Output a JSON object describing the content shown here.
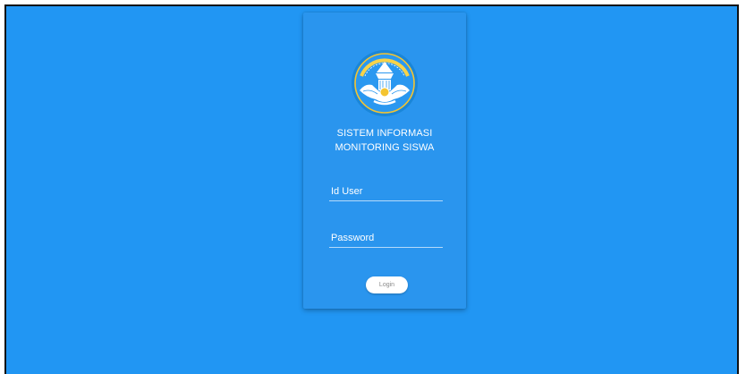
{
  "app": {
    "title_line1": "SISTEM INFORMASI",
    "title_line2": "MONITORING SISWA",
    "logo_icon": "tut-wuri-handayani-logo-icon"
  },
  "form": {
    "user_placeholder": "Id User",
    "password_placeholder": "Password",
    "login_label": "Login"
  },
  "colors": {
    "background": "#2196f3",
    "card": "#2a95ee",
    "logo_ring": "#1a86d8",
    "text": "#ffffff"
  }
}
